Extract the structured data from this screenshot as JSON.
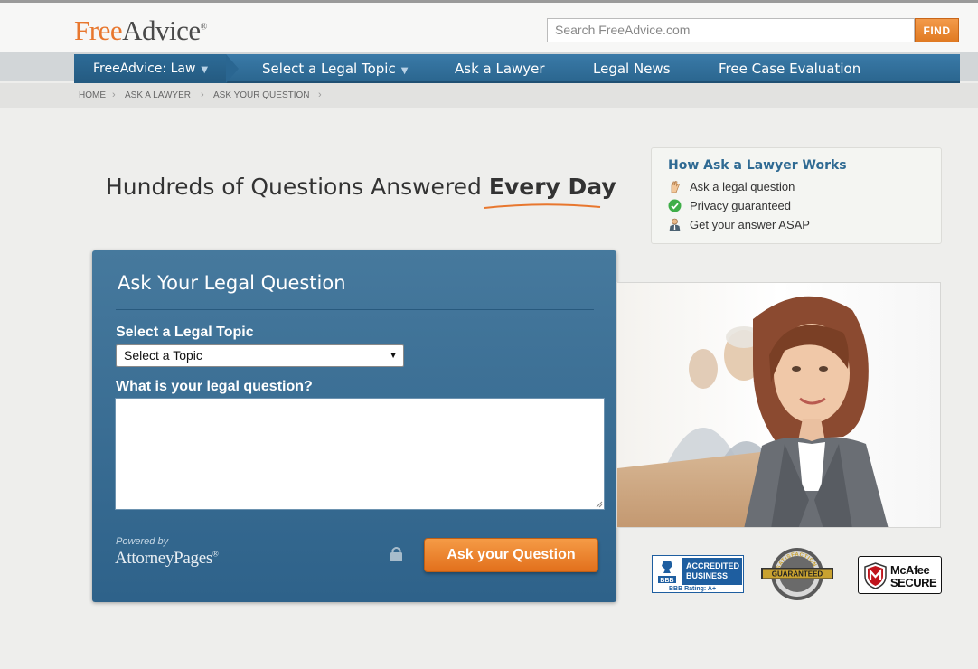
{
  "header": {
    "logo_free": "Free",
    "logo_advice": "Advice",
    "logo_reg": "®",
    "search_placeholder": "Search FreeAdvice.com",
    "find_label": "FIND"
  },
  "nav": {
    "home_label": "FreeAdvice: Law",
    "items": [
      {
        "label": "Select a Legal Topic",
        "has_caret": true
      },
      {
        "label": "Ask a Lawyer"
      },
      {
        "label": "Legal News"
      },
      {
        "label": "Free Case Evaluation"
      }
    ]
  },
  "breadcrumb": [
    "HOME",
    "ASK A LAWYER",
    "ASK YOUR QUESTION"
  ],
  "headline": {
    "main": "Hundreds of Questions Answered ",
    "bold": "Every Day"
  },
  "how": {
    "title": "How Ask a Lawyer Works",
    "items": [
      {
        "icon": "hand-icon",
        "text": "Ask a legal question"
      },
      {
        "icon": "check-icon",
        "text": "Privacy guaranteed"
      },
      {
        "icon": "lawyer-icon",
        "text": "Get your answer ASAP"
      }
    ]
  },
  "form": {
    "title": "Ask Your Legal Question",
    "topic_label": "Select a Legal Topic",
    "topic_selected": "Select a Topic",
    "question_label": "What is your legal question?",
    "question_value": "",
    "powered_by": "Powered by",
    "provider": "AttorneyPages",
    "provider_mark": "®",
    "submit_label": "Ask your Question"
  },
  "badges": {
    "bbb_line1": "ACCREDITED",
    "bbb_line2": "BUSINESS",
    "bbb_rating": "BBB Rating: A+",
    "seal_text": "GUARANTEED",
    "seal_ring": "SATISFACTION",
    "mcafee_line1": "McAfee",
    "mcafee_line2": "SECURE"
  },
  "colors": {
    "brand_orange": "#e8772e",
    "nav_blue": "#2f6d98",
    "panel_blue": "#3a6f95"
  }
}
